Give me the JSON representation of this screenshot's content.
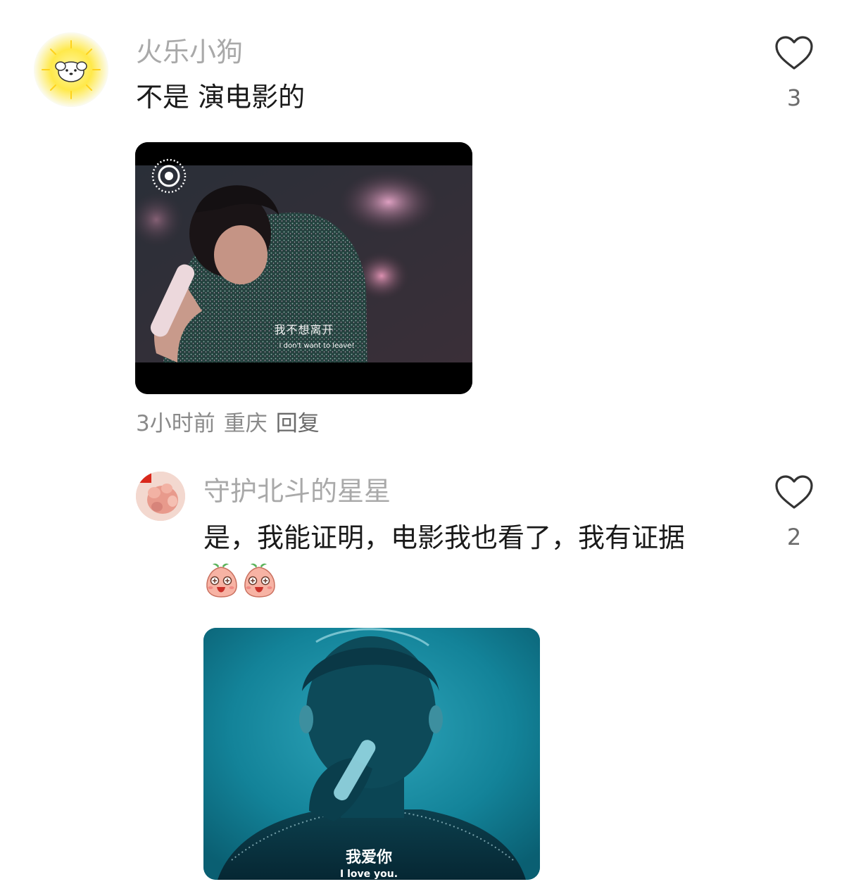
{
  "comments": [
    {
      "username": "火乐小狗",
      "text": "不是 演电影的",
      "likes": "3",
      "image": {
        "subtitle_cn": "我不想离开",
        "subtitle_en": "I don't want to leave!"
      },
      "time": "3小时前",
      "location": "重庆",
      "reply_label": "回复"
    },
    {
      "username": "守护北斗的星星",
      "text": "是，我能证明，电影我也看了，我有证据",
      "likes": "2",
      "emojis": [
        "peach-face-emoji",
        "peach-face-emoji"
      ],
      "image": {
        "subtitle_cn": "我爱你",
        "subtitle_en": "I love you."
      }
    }
  ],
  "colors": {
    "username": "#a9a9a9",
    "text": "#1a1a1a",
    "meta": "#8a8a8a",
    "image2_tint": "#0f6b80"
  },
  "icons": [
    "heart-outline-icon",
    "live-photo-icon"
  ]
}
